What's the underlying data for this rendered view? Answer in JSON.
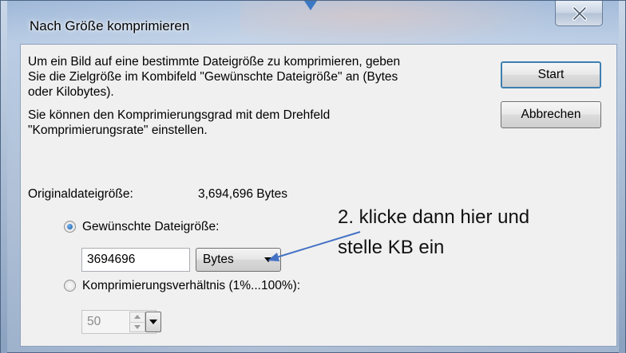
{
  "window": {
    "title": "Nach Größe komprimieren"
  },
  "description": {
    "line1": "Um ein Bild auf eine bestimmte Dateigröße zu komprimieren, geben",
    "line2": "Sie die Zielgröße im Kombifeld \"Gewünschte Dateigröße\" an (Bytes",
    "line3": "oder Kilobytes).",
    "line4": "Sie können den Komprimierungsgrad mit dem Drehfeld",
    "line5": "\"Komprimierungsrate\" einstellen."
  },
  "buttons": {
    "start": "Start",
    "cancel": "Abbrechen"
  },
  "original_size": {
    "label": "Originaldateigröße:",
    "value": "3,694,696 Bytes"
  },
  "desired_size": {
    "label": "Gewünschte Dateigröße:",
    "checked": true,
    "value": "3694696",
    "unit": "Bytes"
  },
  "compression_ratio": {
    "label": "Komprimierungsverhältnis (1%...100%):",
    "checked": false,
    "value": "50"
  },
  "annotation": {
    "line1": "2. klicke dann hier und",
    "line2": "stelle KB ein",
    "color": "#4472c4"
  }
}
